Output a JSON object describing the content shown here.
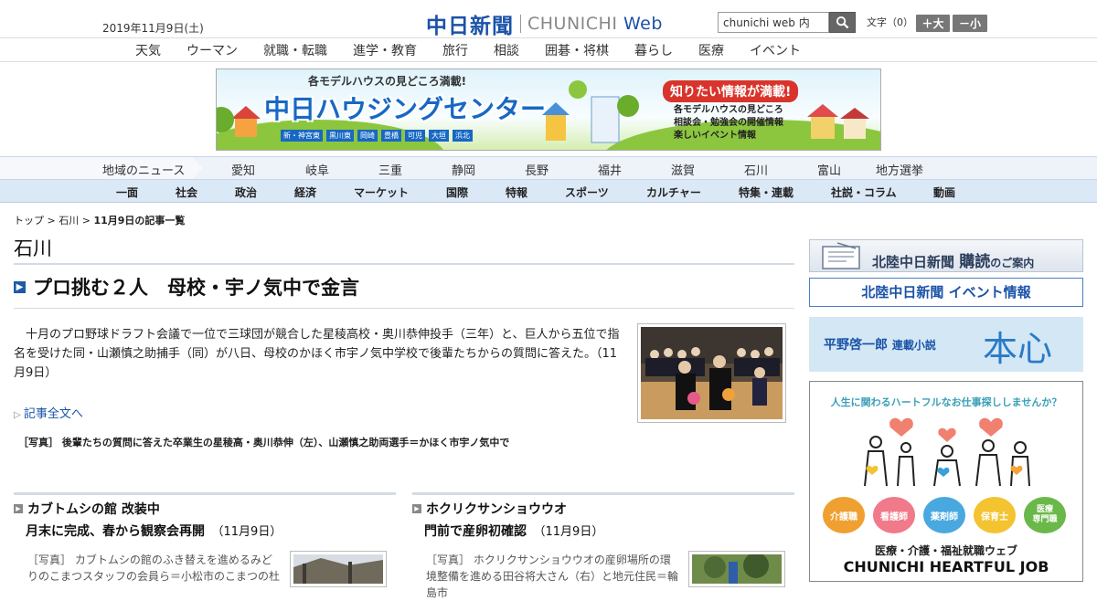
{
  "header": {
    "date": "2019年11月9日(土)",
    "logo_jp": "中日新聞",
    "logo_en_a": "CHUNICHI",
    "logo_en_b": "Web",
    "search_value": "chunichi web 内",
    "fontsize_label": "文字（0）",
    "font_up": "＋大",
    "font_down": "－小"
  },
  "category_nav": [
    "天気",
    "ウーマン",
    "就職・転職",
    "進学・教育",
    "旅行",
    "相談",
    "囲碁・将棋",
    "暮らし",
    "医療",
    "イベント"
  ],
  "banner": {
    "top": "各モデルハウスの見どころ満載!",
    "title": "中日ハウジングセンター",
    "places": [
      "新・神宮東",
      "黒川東",
      "岡崎",
      "豊橋",
      "可児",
      "大垣",
      "浜北"
    ],
    "badge": "知りたい情報が満載!",
    "bullets": [
      "各モデルハウスの見どころ",
      "相談会・勉強会の開催情報",
      "楽しいイベント情報"
    ]
  },
  "region_nav": {
    "label": "地域のニュース",
    "items": [
      "愛知",
      "岐阜",
      "三重",
      "静岡",
      "長野",
      "福井",
      "滋賀",
      "石川",
      "富山",
      "地方選挙"
    ]
  },
  "main_nav": [
    "一面",
    "社会",
    "政治",
    "経済",
    "マーケット",
    "国際",
    "特報",
    "スポーツ",
    "カルチャー",
    "特集・連載",
    "社説・コラム",
    "動画"
  ],
  "breadcrumb": {
    "top": "トップ",
    "sep": ">",
    "region": "石川",
    "current": "11月9日の記事一覧"
  },
  "page_title": "石川",
  "lead": {
    "headline": "プロ挑む２人　母校・宇ノ気中で金言",
    "summary": "十月のプロ野球ドラフト会議で一位で三球団が競合した星稜高校・奥川恭伸投手（三年）と、巨人から五位で指名を受けた同・山瀬慎之助捕手（同）が八日、母校のかほく市宇ノ気中学校で後輩たちからの質問に答えた。（11月9日）",
    "more": "記事全文へ",
    "caption": "［写真］ 後輩たちの質問に答えた卒業生の星稜高・奥川恭伸（左）、山瀬慎之助両選手＝かほく市宇ノ気中で"
  },
  "sub_articles": [
    {
      "title1": "カブトムシの館 改装中",
      "title2": "月末に完成、春から観察会再開",
      "date": "（11月9日）",
      "text": "［写真］ カブトムシの館のふき替えを進めるみどりのこまつスタッフの会員ら＝小松市のこまつの杜"
    },
    {
      "title1": "ホクリクサンショウウオ",
      "title2": "門前で産卵初確認",
      "date": "（11月9日）",
      "text": "［写真］ ホクリクサンショウウオの産卵場所の環境整備を進める田谷将大さん（右）と地元住民＝輪島市"
    }
  ],
  "sidebar": {
    "subscribe_a": "北陸中日新聞",
    "subscribe_b": "購読",
    "subscribe_c": "のご案内",
    "event_a": "北陸中日新聞",
    "event_b": "イベント情報",
    "novel_author": "平野啓一郎",
    "novel_label": "連載小説",
    "novel_title": "本心",
    "job_tagline": "人生に関わるハートフルなお仕事探ししませんか？",
    "job_badges": [
      "介護職",
      "看護師",
      "薬剤師",
      "保育士",
      "医療\n専門職"
    ],
    "job_sub": "医療・介護・福祉就職ウェブ",
    "job_title": "CHUNICHI HEARTFUL JOB"
  },
  "colors": {
    "brand_blue": "#1a52a8",
    "nav_bg": "#dbe8f6",
    "region_bg": "#eef3fa",
    "banner_title": "#1768c4",
    "novel_title": "#2a7ac8"
  }
}
